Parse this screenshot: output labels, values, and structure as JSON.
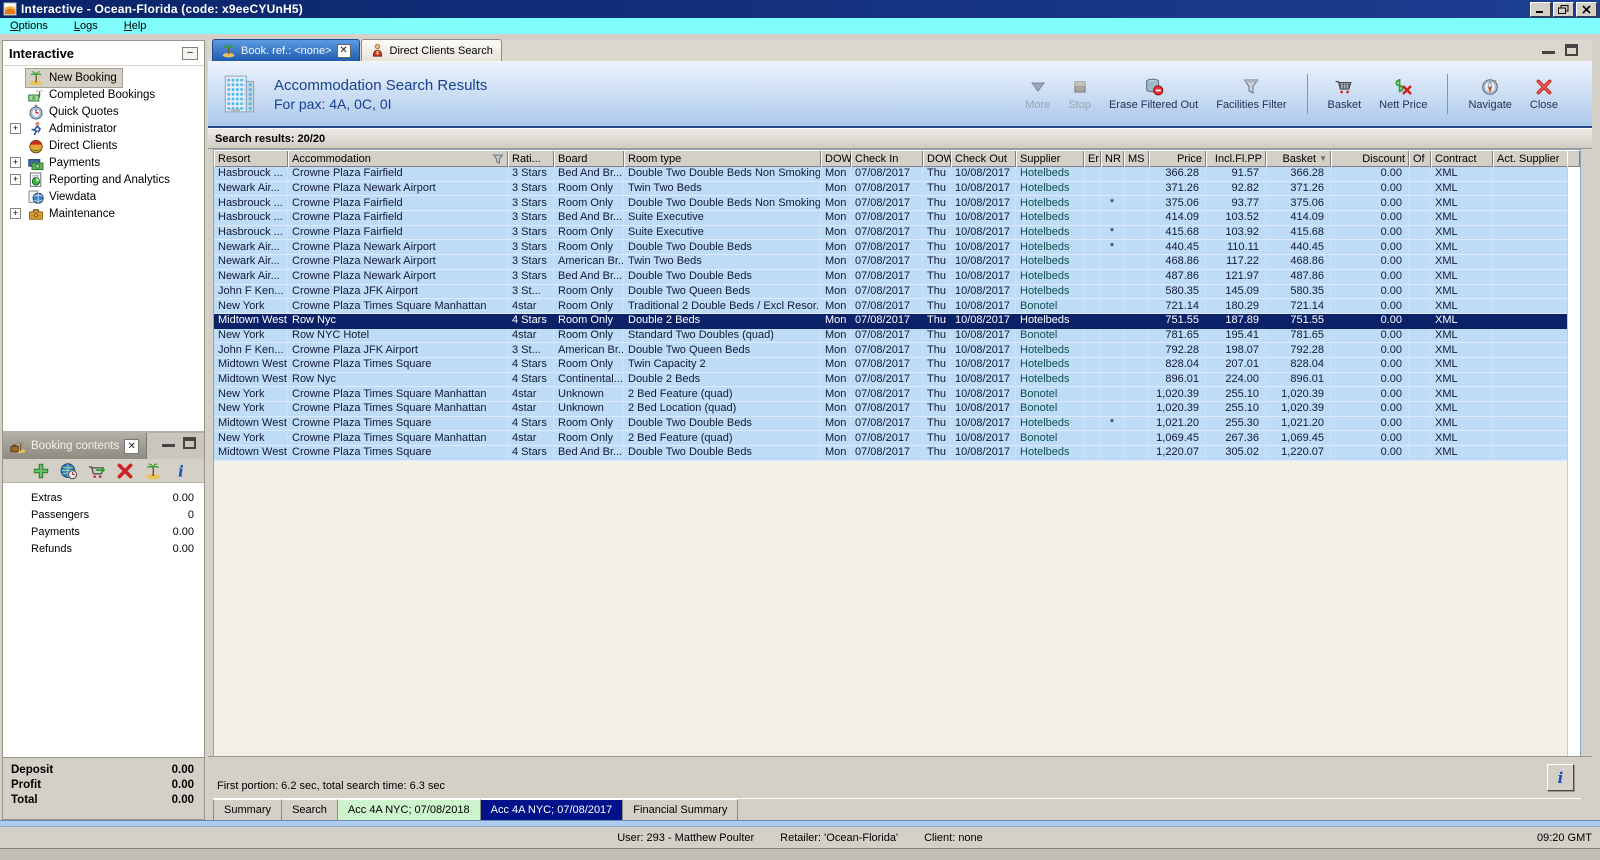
{
  "window": {
    "title": "Interactive - Ocean-Florida (code: x9eeCYUnH5)"
  },
  "menu": [
    "Options",
    "Logs",
    "Help"
  ],
  "colors": {
    "titlebar": "#0a246a",
    "menubar": "#7ffcfc",
    "chrome": "#d4d0c8",
    "row_bg": "#bfdcf7",
    "row_selected_bg": "#0b2268",
    "banner_text": "#17418f",
    "bottom_tab_green": "#cdf4cd",
    "bottom_tab_navy": "#001289",
    "supplier_text": "#0f4f4f"
  },
  "sidebar": {
    "title": "Interactive",
    "items": [
      {
        "label": "New Booking",
        "icon": "palm-island-icon",
        "expandable": false,
        "selected": true
      },
      {
        "label": "Completed Bookings",
        "icon": "money-palm-icon",
        "expandable": false
      },
      {
        "label": "Quick Quotes",
        "icon": "stopwatch-icon",
        "expandable": false
      },
      {
        "label": "Administrator",
        "icon": "runner-icon",
        "expandable": true
      },
      {
        "label": "Direct Clients",
        "icon": "globe-client-icon",
        "expandable": false
      },
      {
        "label": "Payments",
        "icon": "payments-icon",
        "expandable": true
      },
      {
        "label": "Reporting and Analytics",
        "icon": "report-icon",
        "expandable": true
      },
      {
        "label": "Viewdata",
        "icon": "viewdata-icon",
        "expandable": false
      },
      {
        "label": "Maintenance",
        "icon": "toolbox-icon",
        "expandable": true
      }
    ]
  },
  "booking_contents": {
    "title": "Booking contents",
    "toolbar": [
      {
        "name": "add-item-button",
        "icon": "plus-icon"
      },
      {
        "name": "quote-button",
        "icon": "globe-clock-icon"
      },
      {
        "name": "move-to-basket-button",
        "icon": "cart-arrow-icon"
      },
      {
        "name": "delete-button",
        "icon": "red-x-icon"
      },
      {
        "name": "holiday-button",
        "icon": "palm-island-icon"
      },
      {
        "name": "info-button",
        "icon": "info-icon"
      }
    ],
    "rows": [
      {
        "label": "Extras",
        "value": "0.00"
      },
      {
        "label": "Passengers",
        "value": "0"
      },
      {
        "label": "Payments",
        "value": "0.00"
      },
      {
        "label": "Refunds",
        "value": "0.00"
      }
    ],
    "totals": [
      {
        "label": "Deposit",
        "value": "0.00"
      },
      {
        "label": "Profit",
        "value": "0.00"
      },
      {
        "label": "Total",
        "value": "0.00"
      }
    ]
  },
  "main_tabs": [
    {
      "label": "Book. ref.: <none>",
      "icon": "palm-island-icon",
      "active": true,
      "closable": true
    },
    {
      "label": "Direct Clients Search",
      "icon": "person-icon",
      "active": false,
      "closable": false
    }
  ],
  "header": {
    "title": "Accommodation Search Results",
    "subtitle": "For pax: 4A, 0C, 0I"
  },
  "toolbar": [
    {
      "label": "More",
      "icon": "more-icon",
      "disabled": true
    },
    {
      "label": "Stop",
      "icon": "stop-icon",
      "disabled": true
    },
    {
      "label": "Erase Filtered Out",
      "icon": "erase-filter-icon"
    },
    {
      "label": "Facilities Filter",
      "icon": "funnel-icon"
    },
    {
      "separator": true
    },
    {
      "label": "Basket",
      "icon": "basket-icon"
    },
    {
      "label": "Nett Price",
      "icon": "nett-price-icon"
    },
    {
      "separator": true
    },
    {
      "label": "Navigate",
      "icon": "compass-icon"
    },
    {
      "label": "Close",
      "icon": "close-red-icon"
    }
  ],
  "results": {
    "summary": "Search results: 20/20",
    "footer": "First portion: 6.2 sec, total search time: 6.3 sec",
    "selected_index": 10,
    "columns": [
      {
        "label": "Resort"
      },
      {
        "label": "Accommodation",
        "icon": "filter-funnel-icon"
      },
      {
        "label": "Rati..."
      },
      {
        "label": "Board"
      },
      {
        "label": "Room type"
      },
      {
        "label": "DOW"
      },
      {
        "label": "Check In"
      },
      {
        "label": "DOW"
      },
      {
        "label": "Check Out"
      },
      {
        "label": "Supplier"
      },
      {
        "label": "Er"
      },
      {
        "label": "NR"
      },
      {
        "label": "MS"
      },
      {
        "label": "Price",
        "align": "right"
      },
      {
        "label": "Incl.Fl.PP",
        "align": "right"
      },
      {
        "label": "Basket",
        "align": "right",
        "sort": "desc"
      },
      {
        "label": "Discount",
        "align": "right"
      },
      {
        "label": "Of"
      },
      {
        "label": "Contract"
      },
      {
        "label": "Act. Supplier"
      }
    ],
    "rows": [
      [
        "Hasbrouck ...",
        "Crowne Plaza Fairfield",
        "3 Stars",
        "Bed And Br...",
        "Double Two Double Beds Non Smoking",
        "Mon",
        "07/08/2017",
        "Thu",
        "10/08/2017",
        "Hotelbeds",
        "",
        "",
        "",
        "366.28",
        "91.57",
        "366.28",
        "0.00",
        "",
        "XML",
        ""
      ],
      [
        "Newark Air...",
        "Crowne Plaza Newark Airport",
        "3 Stars",
        "Room Only",
        "Twin Two Beds",
        "Mon",
        "07/08/2017",
        "Thu",
        "10/08/2017",
        "Hotelbeds",
        "",
        "",
        "",
        "371.26",
        "92.82",
        "371.26",
        "0.00",
        "",
        "XML",
        ""
      ],
      [
        "Hasbrouck ...",
        "Crowne Plaza Fairfield",
        "3 Stars",
        "Room Only",
        "Double Two Double Beds Non Smoking",
        "Mon",
        "07/08/2017",
        "Thu",
        "10/08/2017",
        "Hotelbeds",
        "",
        "*",
        "",
        "375.06",
        "93.77",
        "375.06",
        "0.00",
        "",
        "XML",
        ""
      ],
      [
        "Hasbrouck ...",
        "Crowne Plaza Fairfield",
        "3 Stars",
        "Bed And Br...",
        "Suite Executive",
        "Mon",
        "07/08/2017",
        "Thu",
        "10/08/2017",
        "Hotelbeds",
        "",
        "",
        "",
        "414.09",
        "103.52",
        "414.09",
        "0.00",
        "",
        "XML",
        ""
      ],
      [
        "Hasbrouck ...",
        "Crowne Plaza Fairfield",
        "3 Stars",
        "Room Only",
        "Suite Executive",
        "Mon",
        "07/08/2017",
        "Thu",
        "10/08/2017",
        "Hotelbeds",
        "",
        "*",
        "",
        "415.68",
        "103.92",
        "415.68",
        "0.00",
        "",
        "XML",
        ""
      ],
      [
        "Newark Air...",
        "Crowne Plaza Newark Airport",
        "3 Stars",
        "Room Only",
        "Double Two Double Beds",
        "Mon",
        "07/08/2017",
        "Thu",
        "10/08/2017",
        "Hotelbeds",
        "",
        "*",
        "",
        "440.45",
        "110.11",
        "440.45",
        "0.00",
        "",
        "XML",
        ""
      ],
      [
        "Newark Air...",
        "Crowne Plaza Newark Airport",
        "3 Stars",
        "American Br...",
        "Twin Two Beds",
        "Mon",
        "07/08/2017",
        "Thu",
        "10/08/2017",
        "Hotelbeds",
        "",
        "",
        "",
        "468.86",
        "117.22",
        "468.86",
        "0.00",
        "",
        "XML",
        ""
      ],
      [
        "Newark Air...",
        "Crowne Plaza Newark Airport",
        "3 Stars",
        "Bed And Br...",
        "Double Two Double Beds",
        "Mon",
        "07/08/2017",
        "Thu",
        "10/08/2017",
        "Hotelbeds",
        "",
        "",
        "",
        "487.86",
        "121.97",
        "487.86",
        "0.00",
        "",
        "XML",
        ""
      ],
      [
        "John F Ken...",
        "Crowne Plaza JFK Airport",
        "3 St...",
        "Room Only",
        "Double Two Queen Beds",
        "Mon",
        "07/08/2017",
        "Thu",
        "10/08/2017",
        "Hotelbeds",
        "",
        "",
        "",
        "580.35",
        "145.09",
        "580.35",
        "0.00",
        "",
        "XML",
        ""
      ],
      [
        "New York",
        "Crowne Plaza Times Square Manhattan",
        "4star",
        "Room Only",
        "Traditional 2 Double Beds / Excl Resor...",
        "Mon",
        "07/08/2017",
        "Thu",
        "10/08/2017",
        "Bonotel",
        "",
        "",
        "",
        "721.14",
        "180.29",
        "721.14",
        "0.00",
        "",
        "XML",
        ""
      ],
      [
        "Midtown West",
        "Row Nyc",
        "4 Stars",
        "Room Only",
        "Double 2 Beds",
        "Mon",
        "07/08/2017",
        "Thu",
        "10/08/2017",
        "Hotelbeds",
        "",
        "",
        "",
        "751.55",
        "187.89",
        "751.55",
        "0.00",
        "",
        "XML",
        ""
      ],
      [
        "New York",
        "Row NYC Hotel",
        "4star",
        "Room Only",
        "Standard Two Doubles (quad)",
        "Mon",
        "07/08/2017",
        "Thu",
        "10/08/2017",
        "Bonotel",
        "",
        "",
        "",
        "781.65",
        "195.41",
        "781.65",
        "0.00",
        "",
        "XML",
        ""
      ],
      [
        "John F Ken...",
        "Crowne Plaza JFK Airport",
        "3 St...",
        "American Br...",
        "Double Two Queen Beds",
        "Mon",
        "07/08/2017",
        "Thu",
        "10/08/2017",
        "Hotelbeds",
        "",
        "",
        "",
        "792.28",
        "198.07",
        "792.28",
        "0.00",
        "",
        "XML",
        ""
      ],
      [
        "Midtown West",
        "Crowne Plaza Times Square",
        "4 Stars",
        "Room Only",
        "Twin Capacity 2",
        "Mon",
        "07/08/2017",
        "Thu",
        "10/08/2017",
        "Hotelbeds",
        "",
        "",
        "",
        "828.04",
        "207.01",
        "828.04",
        "0.00",
        "",
        "XML",
        ""
      ],
      [
        "Midtown West",
        "Row Nyc",
        "4 Stars",
        "Continental...",
        "Double 2 Beds",
        "Mon",
        "07/08/2017",
        "Thu",
        "10/08/2017",
        "Hotelbeds",
        "",
        "",
        "",
        "896.01",
        "224.00",
        "896.01",
        "0.00",
        "",
        "XML",
        ""
      ],
      [
        "New York",
        "Crowne Plaza Times Square Manhattan",
        "4star",
        "Unknown",
        "2 Bed Feature (quad)",
        "Mon",
        "07/08/2017",
        "Thu",
        "10/08/2017",
        "Bonotel",
        "",
        "",
        "",
        "1,020.39",
        "255.10",
        "1,020.39",
        "0.00",
        "",
        "XML",
        ""
      ],
      [
        "New York",
        "Crowne Plaza Times Square Manhattan",
        "4star",
        "Unknown",
        "2 Bed Location (quad)",
        "Mon",
        "07/08/2017",
        "Thu",
        "10/08/2017",
        "Bonotel",
        "",
        "",
        "",
        "1,020.39",
        "255.10",
        "1,020.39",
        "0.00",
        "",
        "XML",
        ""
      ],
      [
        "Midtown West",
        "Crowne Plaza Times Square",
        "4 Stars",
        "Room Only",
        "Double Two Double Beds",
        "Mon",
        "07/08/2017",
        "Thu",
        "10/08/2017",
        "Hotelbeds",
        "",
        "*",
        "",
        "1,021.20",
        "255.30",
        "1,021.20",
        "0.00",
        "",
        "XML",
        ""
      ],
      [
        "New York",
        "Crowne Plaza Times Square Manhattan",
        "4star",
        "Room Only",
        "2 Bed Feature (quad)",
        "Mon",
        "07/08/2017",
        "Thu",
        "10/08/2017",
        "Bonotel",
        "",
        "",
        "",
        "1,069.45",
        "267.36",
        "1,069.45",
        "0.00",
        "",
        "XML",
        ""
      ],
      [
        "Midtown West",
        "Crowne Plaza Times Square",
        "4 Stars",
        "Bed And Br...",
        "Double Two Double Beds",
        "Mon",
        "07/08/2017",
        "Thu",
        "10/08/2017",
        "Hotelbeds",
        "",
        "",
        "",
        "1,220.07",
        "305.02",
        "1,220.07",
        "0.00",
        "",
        "XML",
        ""
      ]
    ]
  },
  "bottom_tabs": [
    {
      "label": "Summary"
    },
    {
      "label": "Search"
    },
    {
      "label": "Acc 4A NYC; 07/08/2018",
      "variant": "green"
    },
    {
      "label": "Acc 4A NYC; 07/08/2017",
      "variant": "navy"
    },
    {
      "label": "Financial Summary"
    }
  ],
  "statusbar": {
    "user": "User: 293 - Matthew Poulter",
    "retailer": "Retailer: 'Ocean-Florida'",
    "client": "Client: none",
    "time": "09:20 GMT"
  }
}
